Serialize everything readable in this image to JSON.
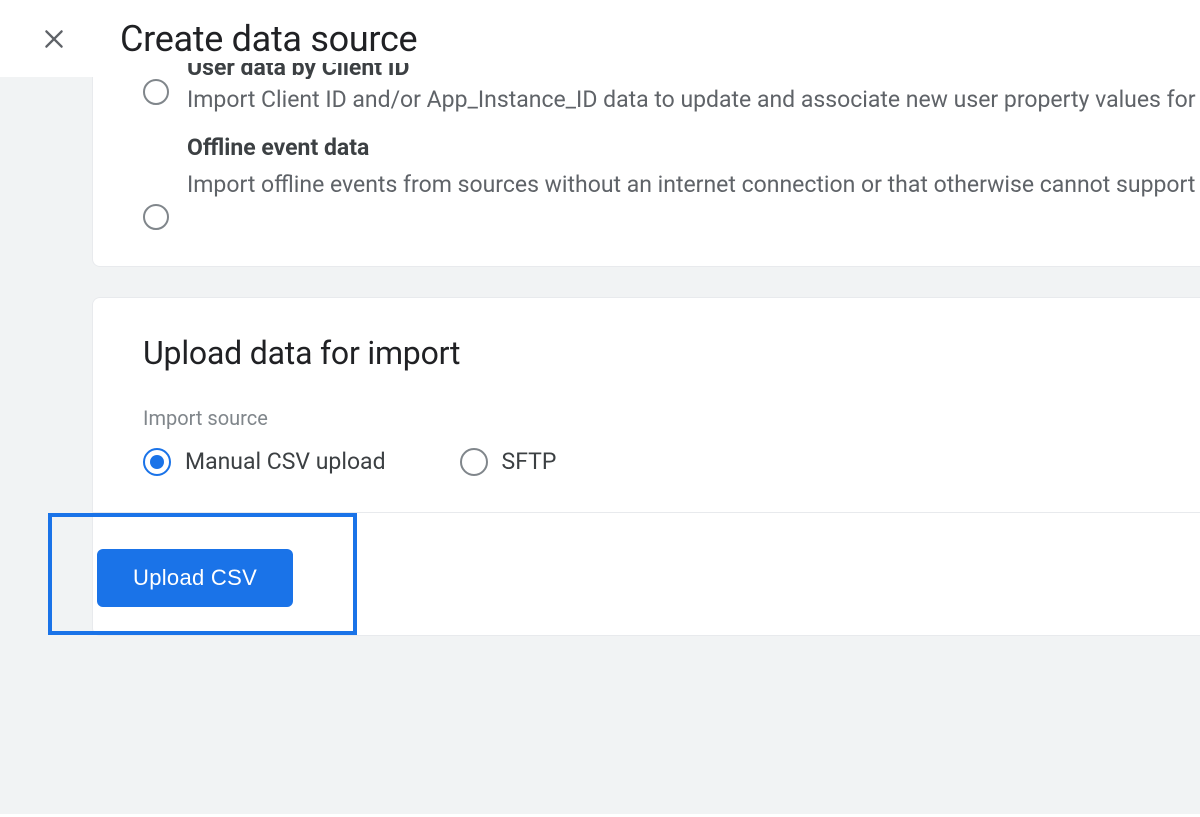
{
  "header": {
    "title": "Create data source"
  },
  "data_types": {
    "user_data": {
      "title": "User data by Client ID",
      "description": "Import Client ID and/or App_Instance_ID data to update and associate new user property values for each id you upload, based on your other data sources. Removing this data requires a user or data"
    },
    "offline_event": {
      "title": "Offline event data",
      "description": "Import offline events from sources without an internet connection or that otherwise cannot support time event collection via SDKs or Measurement Protocol. These events, once uploaded, are processed though they were collected via our SDKs using the timestamp provided or the time of upload if non provided. Removing this data requires a user or data deletion."
    }
  },
  "upload_section": {
    "title": "Upload data for import",
    "import_source_label": "Import source",
    "options": {
      "manual_csv": "Manual CSV upload",
      "sftp": "SFTP"
    },
    "upload_button": "Upload CSV"
  }
}
